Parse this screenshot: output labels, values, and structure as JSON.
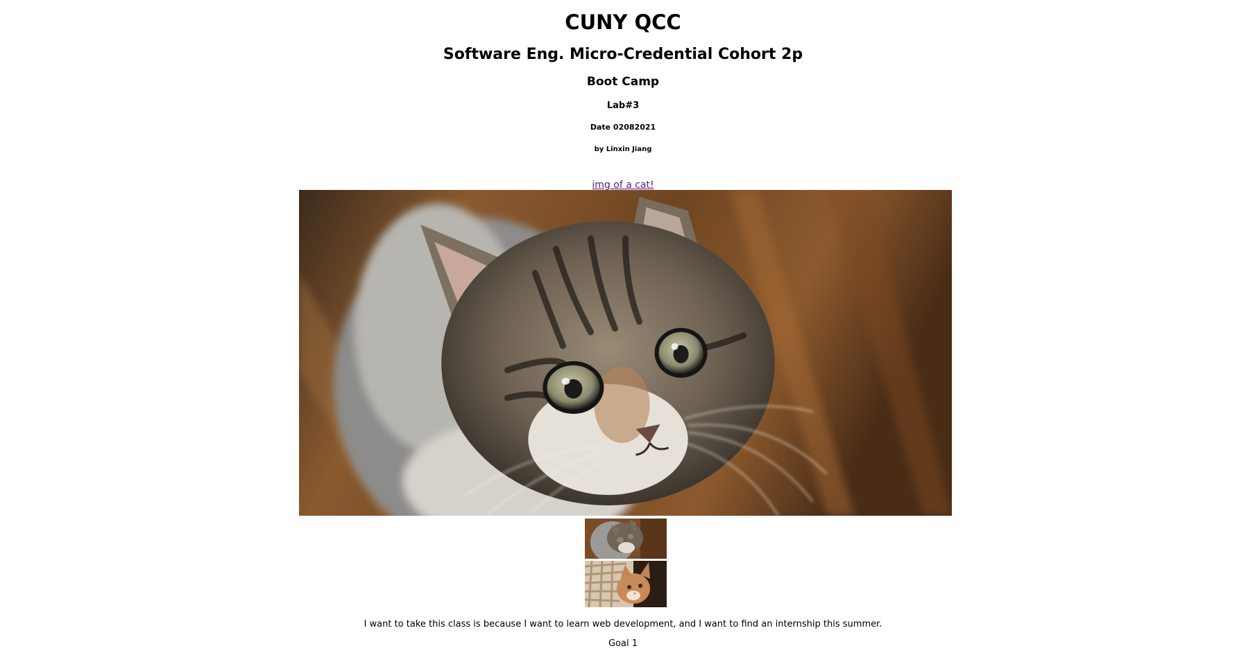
{
  "header": {
    "school": "CUNY QCC",
    "program": "Software Eng. Micro-Credential Cohort 2p",
    "track": "Boot Camp",
    "lab": "Lab#3",
    "date": "Date 02082021",
    "author": "by Linxin Jiang"
  },
  "gallery": {
    "link_text": "img of a cat!",
    "thumbnails": [
      {
        "name": "tabby-kitten-thumbnail"
      },
      {
        "name": "ginger-kitten-thumbnail"
      }
    ]
  },
  "content": {
    "reason": "I want to take this class is because I want to learn web development, and I want to find an internship this summer.",
    "goal_label": "Goal 1"
  }
}
